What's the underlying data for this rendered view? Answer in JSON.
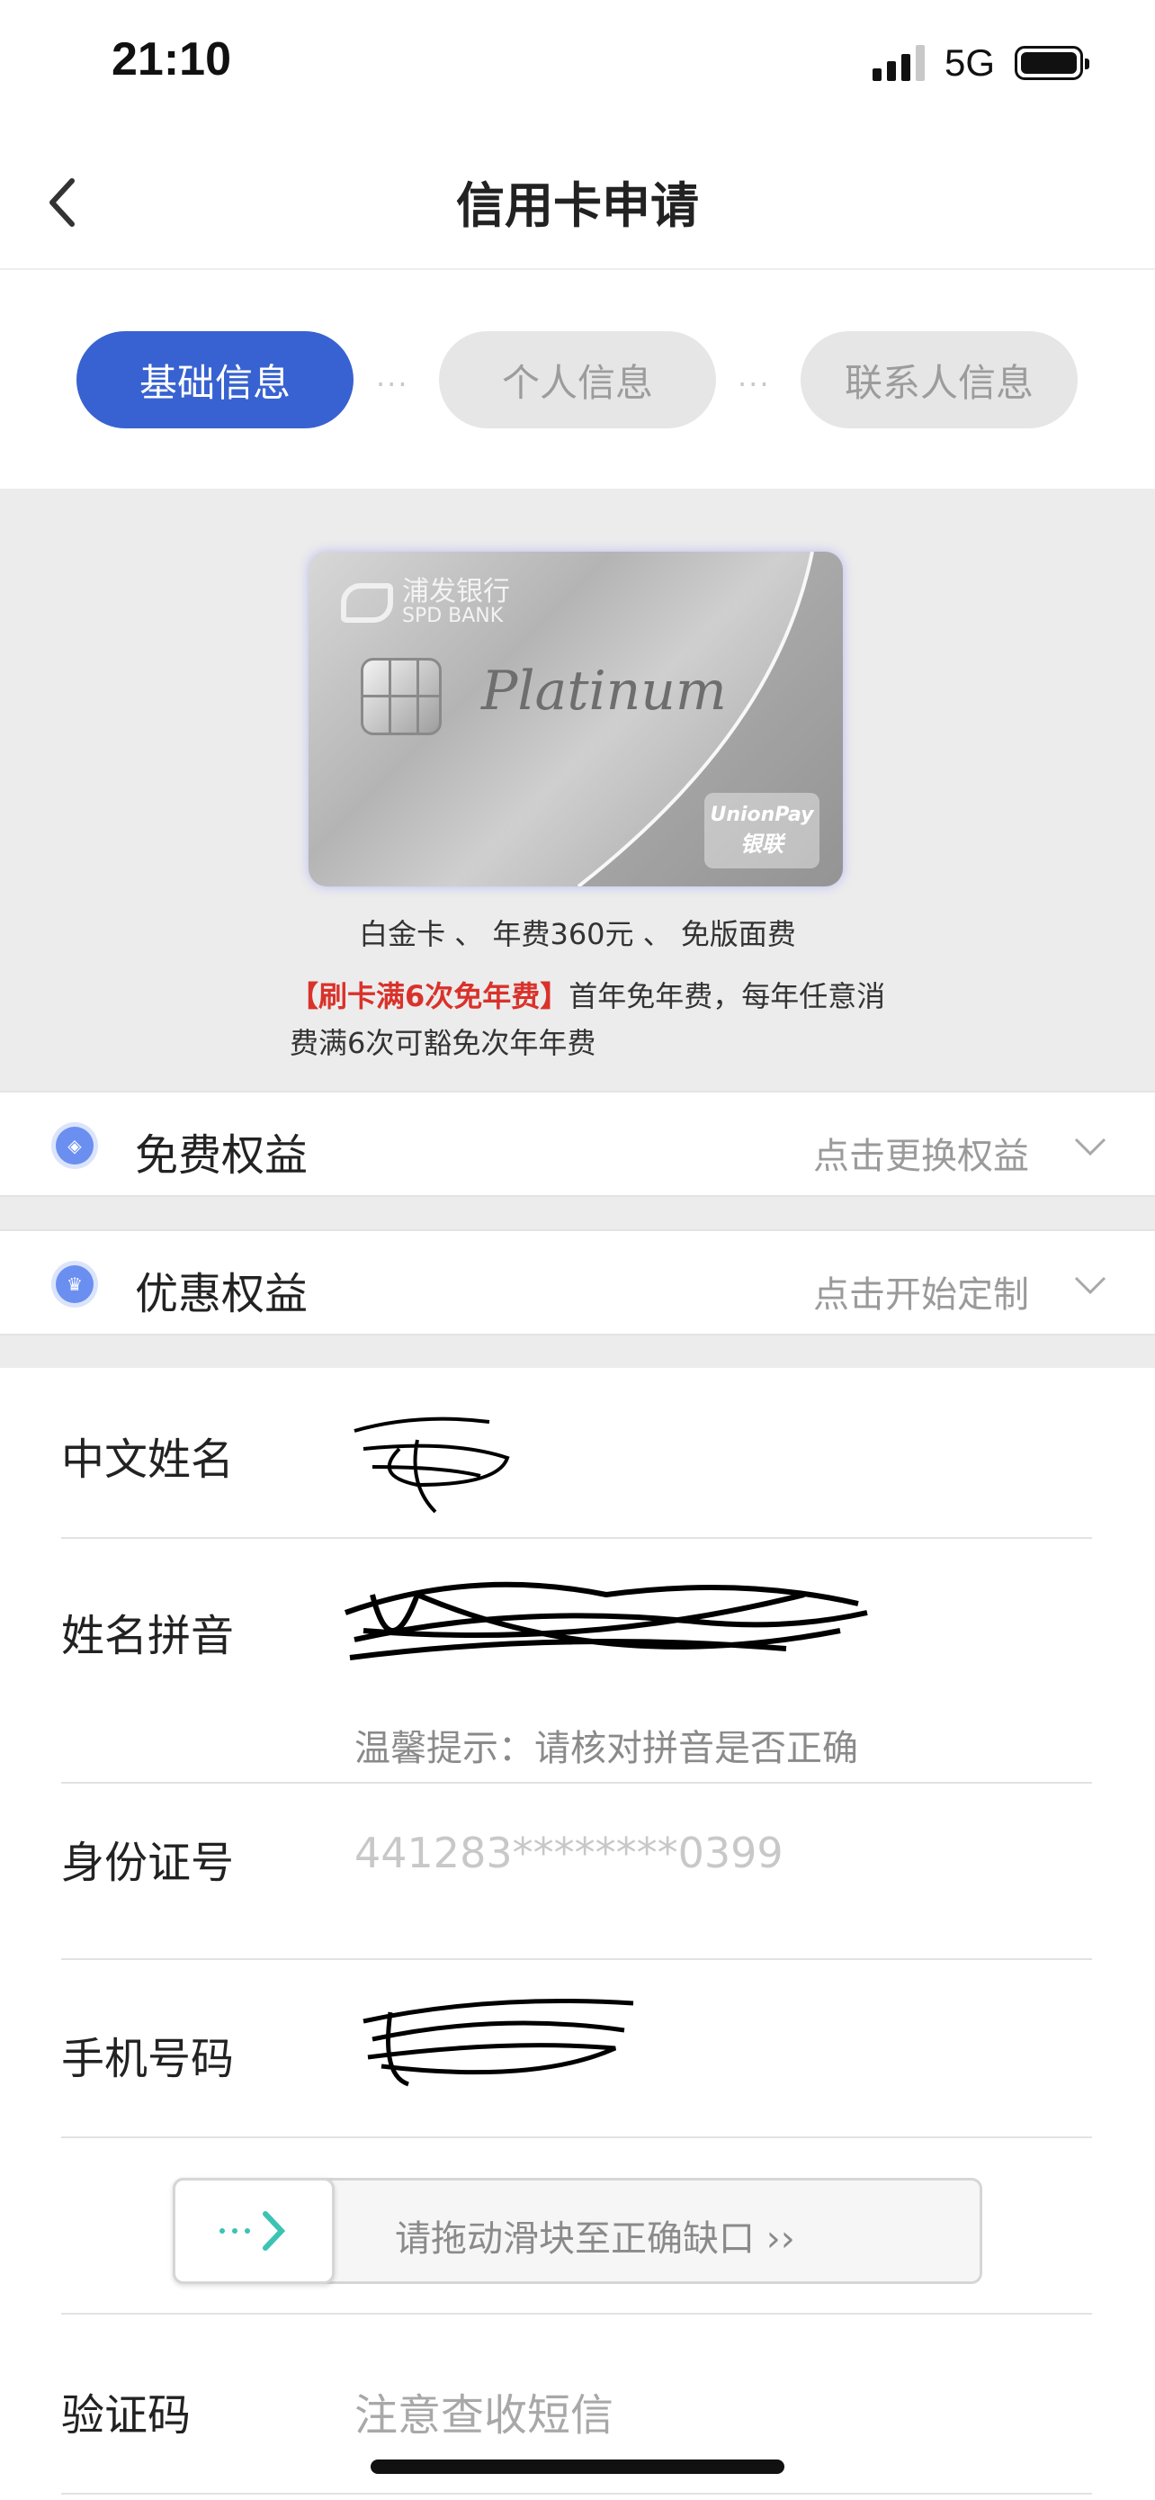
{
  "status_bar": {
    "time": "21:10",
    "network": "5G"
  },
  "nav": {
    "title": "信用卡申请"
  },
  "steps": [
    {
      "label": "基础信息",
      "state": "active"
    },
    {
      "label": "个人信息",
      "state": "inactive"
    },
    {
      "label": "联系人信息",
      "state": "inactive"
    }
  ],
  "step_separator": "···",
  "card": {
    "bank_name_cn": "浦发银行",
    "bank_name_en": "SPD BANK",
    "brand": "Platinum",
    "network_en": "UnionPay",
    "network_cn": "银联",
    "description": "白金卡 、 年费360元 、 免版面费",
    "promo_highlight": "【刷卡满6次免年费】",
    "promo_text": "首年免年费，每年任意消费满6次可豁免次年年费"
  },
  "benefits": [
    {
      "title": "免费权益",
      "action": "点击更换权益",
      "icon": "gift-coin-icon"
    },
    {
      "title": "优惠权益",
      "action": "点击开始定制",
      "icon": "crown-icon"
    }
  ],
  "form": {
    "chinese_name_label": "中文姓名",
    "pinyin_label": "姓名拼音",
    "pinyin_hint": "温馨提示：请核对拼音是否正确",
    "id_label": "身份证号",
    "id_value": "441283********0399",
    "phone_label": "手机号码",
    "slider_text": "请拖动滑块至正确缺口 ››",
    "code_label": "验证码",
    "code_placeholder": "注意查收短信"
  },
  "colors": {
    "primary": "#3862d1",
    "promo_red": "#d9322b",
    "slider_arrow": "#3cc3b3"
  }
}
